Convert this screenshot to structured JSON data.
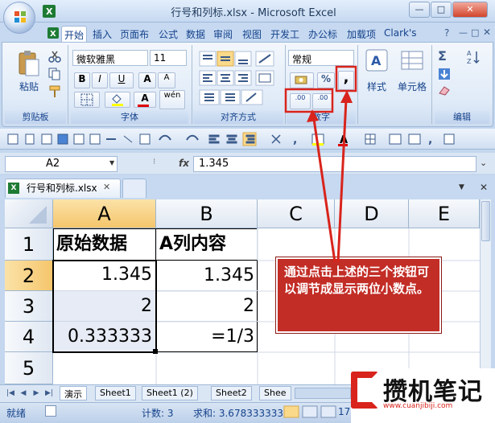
{
  "window": {
    "title": "行号和列标.xlsx - Microsoft Excel",
    "minimize": "—",
    "restore": "□",
    "close": "✕"
  },
  "ribbon_tabs": [
    "开始",
    "插入",
    "页面布",
    "公式",
    "数据",
    "审阅",
    "视图",
    "开发工",
    "办公标",
    "加载项",
    "Clark's"
  ],
  "ribbon": {
    "clipboard": {
      "label": "剪贴板",
      "paste": "粘贴"
    },
    "font": {
      "label": "字体",
      "font_name": "微软雅黑",
      "font_size": "11",
      "bold": "B",
      "italic": "I",
      "underline": "U",
      "grow": "A",
      "shrink": "A",
      "wen": "wén",
      "font_color": "A"
    },
    "alignment": {
      "label": "对齐方式"
    },
    "number": {
      "label": "数字",
      "format": "常规",
      "percent": "%",
      "comma": ",",
      "inc_decimal": ".00",
      "dec_decimal": ".00"
    },
    "styles": {
      "label": "样式"
    },
    "cells": {
      "label": "单元格"
    },
    "editing": {
      "label": "编辑",
      "sum": "Σ"
    }
  },
  "formula_bar": {
    "name_box": "A2",
    "fx": "fx",
    "value": "1.345"
  },
  "workbook_tab": {
    "title": "行号和列标.xlsx",
    "close": "✕"
  },
  "columns": [
    "A",
    "B",
    "C",
    "D",
    "E"
  ],
  "rows": [
    "1",
    "2",
    "3",
    "4",
    "5"
  ],
  "cells": {
    "A1": "原始数据",
    "B1": "A列内容",
    "A2": "1.345",
    "B2": "1.345",
    "A3": "2",
    "B3": "2",
    "A4": "0.333333",
    "B4": "=1/3"
  },
  "callout": "通过点击上述的三个按钮可以调节成显示两位小数点。",
  "sheet_tabs": [
    "演示",
    "Sheet1",
    "Sheet1 (2)",
    "Sheet2",
    "Shee"
  ],
  "statusbar": {
    "mode": "就绪",
    "count": "计数: 3",
    "sum": "求和: 3.678333333",
    "zoom": "175"
  },
  "watermark": {
    "text": "攒机笔记",
    "url": "www.cuanjibiji.com"
  },
  "colors": {
    "callout_bg": "#c22d26",
    "arrow": "#d8241c",
    "selected_header": "#f5c66c"
  }
}
